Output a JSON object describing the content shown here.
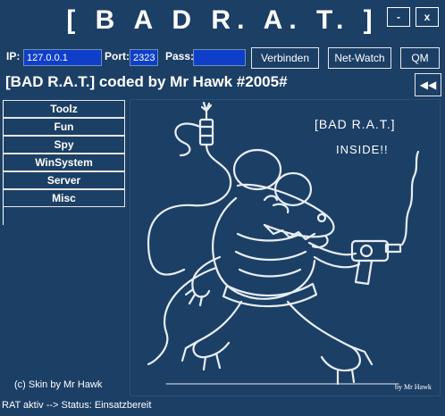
{
  "title": "[ B A D R. A. T. ]",
  "window": {
    "minimize_label": "-",
    "close_label": "x"
  },
  "connection": {
    "ip_label": "IP:",
    "ip_value": "127.0.0.1",
    "port_label": "Port:",
    "port_value": "2323",
    "pass_label": "Pass:",
    "pass_value": "",
    "connect_label": "Verbinden",
    "netwatch_label": "Net-Watch",
    "qm_label": "QM"
  },
  "heading": "[BAD R.A.T.] coded by Mr Hawk #2005#",
  "back_icon": "rewind-icon",
  "back_glyph": "◀◀",
  "menu": {
    "items": [
      {
        "label": "Toolz"
      },
      {
        "label": "Fun"
      },
      {
        "label": "Spy"
      },
      {
        "label": "WinSystem"
      },
      {
        "label": "Server"
      },
      {
        "label": "Misc"
      }
    ]
  },
  "artwork": {
    "caption_line1": "[BAD R.A.T.]",
    "caption_line2": "INSIDE!!",
    "signature": "by Mr Hawk"
  },
  "footer": {
    "skin_credit": "(c) Skin by Mr Hawk",
    "status": "RAT aktiv --> Status: Einsatzbereit"
  },
  "colors": {
    "background": "#1c3f66",
    "input_fill": "#0f3fc8",
    "border": "#e6e6e6",
    "text": "#ffffff"
  }
}
